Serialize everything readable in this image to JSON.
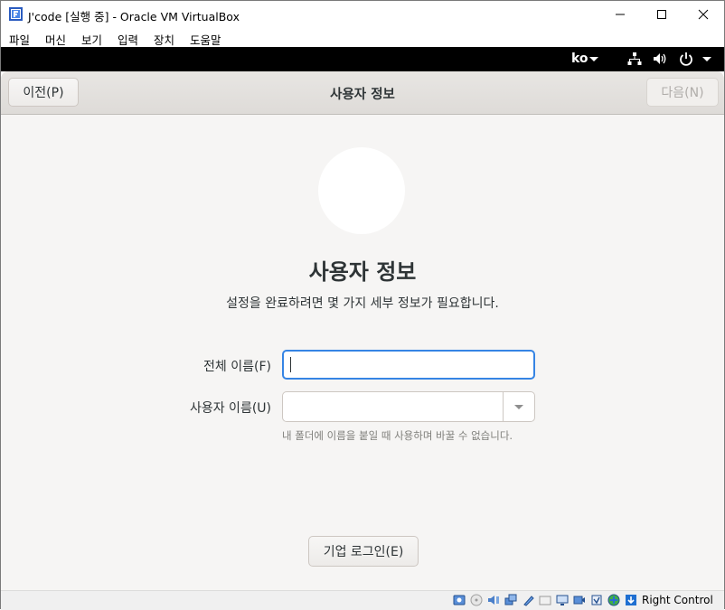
{
  "window": {
    "title": "J'code [실행 중] - Oracle VM VirtualBox",
    "icon": "virtualbox-app-icon",
    "controls": [
      "minimize-icon",
      "maximize-icon",
      "close-icon"
    ]
  },
  "menu": {
    "items": [
      {
        "label": "파일"
      },
      {
        "label": "머신"
      },
      {
        "label": "보기"
      },
      {
        "label": "입력"
      },
      {
        "label": "장치"
      },
      {
        "label": "도움말"
      }
    ]
  },
  "guest_topbar": {
    "language": "ko",
    "icons": [
      "network-icon",
      "volume-icon",
      "power-icon"
    ]
  },
  "header": {
    "back_label": "이전(P)",
    "title": "사용자 정보",
    "next_label": "다음(N)",
    "next_enabled": false
  },
  "page": {
    "title": "사용자 정보",
    "subtitle": "설정을 완료하려면 몇 가지 세부 정보가 필요합니다.",
    "full_name_label": "전체 이름(F)",
    "full_name_value": "",
    "username_label": "사용자 이름(U)",
    "username_value": "",
    "username_hint": "내 폴더에 이름을 붙일 때 사용하며 바꿀 수 없습니다.",
    "enterprise_login_label": "기업 로그인(E)"
  },
  "statusbar": {
    "host_key": "Right Control",
    "icons": [
      "hard-disk-icon",
      "optical-drive-icon",
      "audio-icon",
      "network-adapter-icon",
      "usb-icon",
      "shared-folder-icon",
      "display-icon",
      "recording-icon",
      "cpu-icon",
      "mouse-integration-icon",
      "keyboard-capture-icon"
    ],
    "accent": "#1f6fd1"
  },
  "colors": {
    "focus_border": "#3584e4",
    "guest_bg": "#f6f5f4",
    "gnome_top": "#000000"
  }
}
